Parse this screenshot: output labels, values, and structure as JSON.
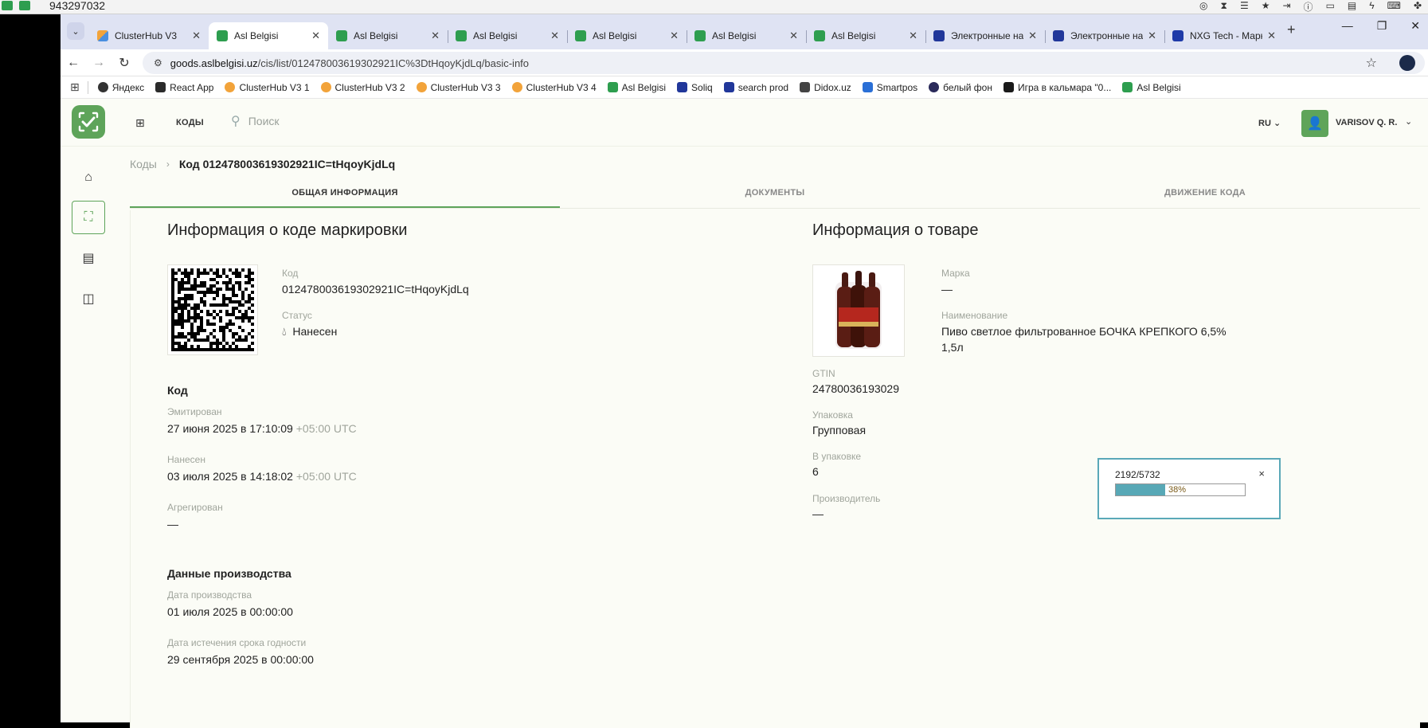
{
  "os": {
    "phone": "943297032"
  },
  "browser": {
    "tabs": [
      {
        "title": "ClusterHub V3",
        "fav": "clusterhub"
      },
      {
        "title": "Asl Belgisi",
        "fav": "green",
        "active": true
      },
      {
        "title": "Asl Belgisi",
        "fav": "green"
      },
      {
        "title": "Asl Belgisi",
        "fav": "green"
      },
      {
        "title": "Asl Belgisi",
        "fav": "green"
      },
      {
        "title": "Asl Belgisi",
        "fav": "green"
      },
      {
        "title": "Asl Belgisi",
        "fav": "green"
      },
      {
        "title": "Электронные на",
        "fav": "shield"
      },
      {
        "title": "Электронные на",
        "fav": "shield"
      },
      {
        "title": "NXG Tech - Марк",
        "fav": "nxg"
      }
    ],
    "url_domain": "goods.aslbelgisi.uz",
    "url_path": "/cis/list/012478003619302921IC%3DtHqoyKjdLq/basic-info",
    "bookmarks": [
      {
        "label": "Яндекс",
        "fav": "globe"
      },
      {
        "label": "React App",
        "fav": "react"
      },
      {
        "label": "ClusterHub V3 1",
        "fav": "clusterhub"
      },
      {
        "label": "ClusterHub V3 2",
        "fav": "clusterhub"
      },
      {
        "label": "ClusterHub V3 3",
        "fav": "clusterhub"
      },
      {
        "label": "ClusterHub V3 4",
        "fav": "clusterhub"
      },
      {
        "label": "Asl Belgisi",
        "fav": "green"
      },
      {
        "label": "Soliq",
        "fav": "shield"
      },
      {
        "label": "search prod",
        "fav": "shield"
      },
      {
        "label": "Didox.uz",
        "fav": "doc"
      },
      {
        "label": "Smartpos",
        "fav": "smartpos"
      },
      {
        "label": "белый фон",
        "fav": "circle"
      },
      {
        "label": "Игра в кальмара \"0...",
        "fav": "r"
      },
      {
        "label": "Asl Belgisi",
        "fav": "green"
      }
    ]
  },
  "header": {
    "nav_codes": "КОДЫ",
    "search_placeholder": "Поиск",
    "lang": "RU",
    "user": "VARISOV Q. R."
  },
  "breadcrumbs": {
    "root": "Коды",
    "current": "Код 012478003619302921IC=tHqoyKjdLq"
  },
  "page_tabs": [
    "ОБЩАЯ ИНФОРМАЦИЯ",
    "ДОКУМЕНТЫ",
    "ДВИЖЕНИЕ КОДА"
  ],
  "marking": {
    "title": "Информация о коде маркировки",
    "code_label": "Код",
    "code_value": "012478003619302921IC=tHqoyKjdLq",
    "status_label": "Статус",
    "status_value": "Нанесен",
    "section_code": "Код",
    "emitted_label": "Эмитирован",
    "emitted_value": "27 июня 2025 в 17:10:09",
    "emitted_tz": "+05:00 UTC",
    "applied_label": "Нанесен",
    "applied_value": "03 июля 2025 в 14:18:02",
    "applied_tz": "+05:00 UTC",
    "aggregated_label": "Агрегирован",
    "aggregated_value": "—",
    "section_production": "Данные производства",
    "prod_date_label": "Дата производства",
    "prod_date_value": "01 июля 2025 в 00:00:00",
    "expiry_label": "Дата истечения срока годности",
    "expiry_value": "29 сентября 2025 в 00:00:00"
  },
  "product": {
    "title": "Информация о товаре",
    "brand_label": "Марка",
    "brand_value": "—",
    "name_label": "Наименование",
    "name_line1": "Пиво светлое фильтрованное БОЧКА КРЕПКОГО 6,5%",
    "name_line2": "1,5л",
    "gtin_label": "GTIN",
    "gtin_value": "24780036193029",
    "package_label": "Упаковка",
    "package_value": "Групповая",
    "in_package_label": "В упаковке",
    "in_package_value": "6",
    "producer_label": "Производитель",
    "producer_value": "—"
  },
  "progress_popup": {
    "count": "2192/5732",
    "percent_label": "38%",
    "percent": 38,
    "close": "×"
  },
  "colors": {
    "brand_green": "#5ea45a",
    "progress_teal": "#58a8b6",
    "background": "#fbfcf6"
  }
}
